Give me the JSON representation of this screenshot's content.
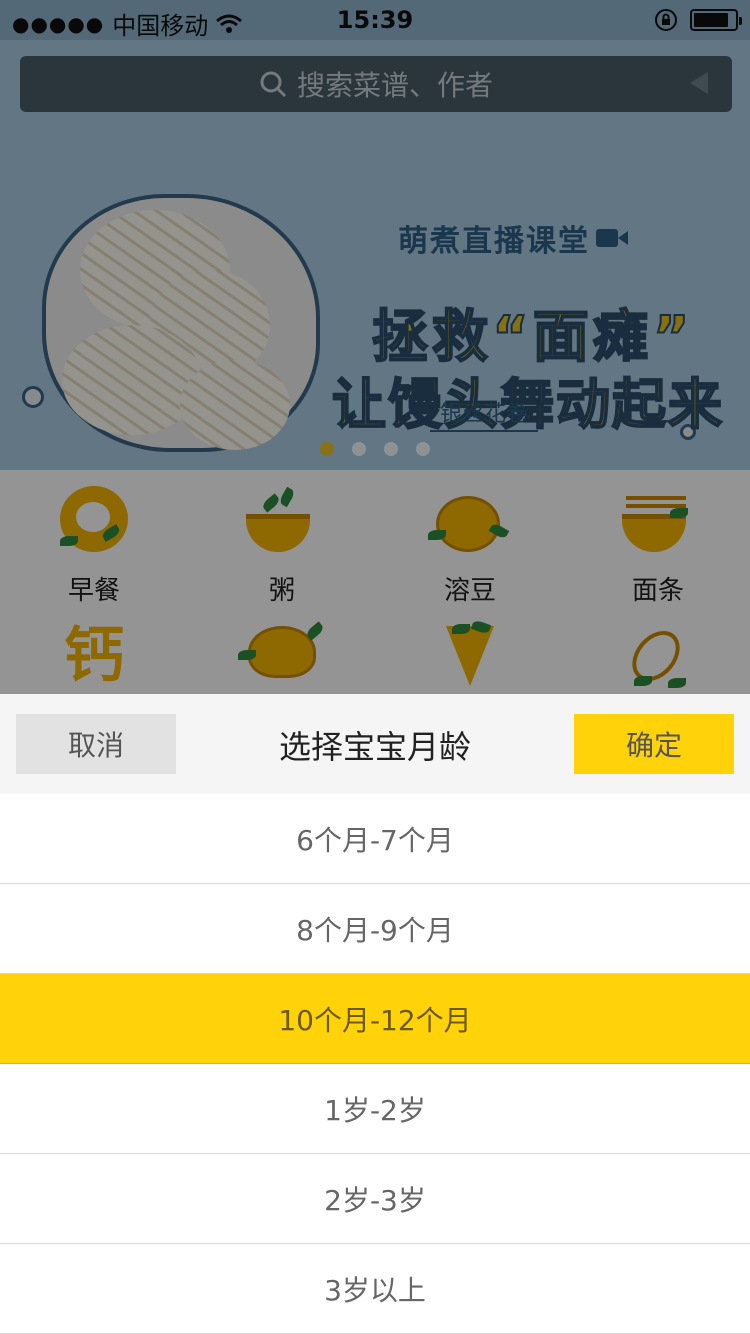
{
  "status_bar": {
    "signal_dots": "●●●●●",
    "carrier": "中国移动",
    "time": "15:39"
  },
  "search": {
    "placeholder": "搜索菜谱、作者"
  },
  "banner": {
    "live_label": "萌煮直播课堂",
    "headline_1": "拯救“面瘫”",
    "headline_2": "让馒头舞动起来",
    "tag": "银丝花卷",
    "page_count": 4,
    "active_page": 1
  },
  "categories": [
    {
      "label": "早餐",
      "icon": "fried-egg-icon"
    },
    {
      "label": "粥",
      "icon": "porridge-bowl-icon"
    },
    {
      "label": "溶豆",
      "icon": "dissolving-bean-icon"
    },
    {
      "label": "面条",
      "icon": "noodle-bowl-icon"
    },
    {
      "label": "",
      "icon": "calcium-char-icon",
      "glyph": "钙"
    },
    {
      "label": "",
      "icon": "croissant-icon"
    },
    {
      "label": "",
      "icon": "crepe-icon"
    },
    {
      "label": "",
      "icon": "whisk-icon"
    }
  ],
  "picker": {
    "cancel_label": "取消",
    "title": "选择宝宝月龄",
    "confirm_label": "确定",
    "options": [
      {
        "label": "6个月-7个月"
      },
      {
        "label": "8个月-9个月"
      },
      {
        "label": "10个月-12个月",
        "selected": true
      },
      {
        "label": "1岁-2岁"
      },
      {
        "label": "2岁-3岁"
      },
      {
        "label": "3岁以上"
      }
    ]
  },
  "colors": {
    "accent": "#ffd20a",
    "banner_bg": "#a9cbe3"
  }
}
